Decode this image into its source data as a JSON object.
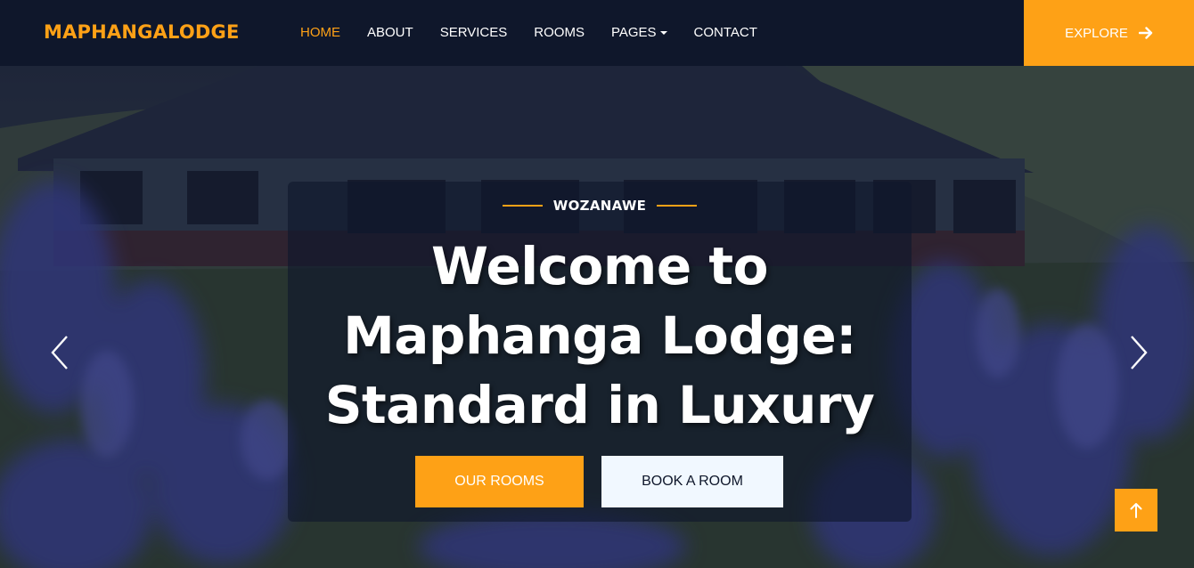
{
  "brand": "MAPHANGALODGE",
  "nav": {
    "items": [
      {
        "label": "HOME",
        "active": true
      },
      {
        "label": "ABOUT"
      },
      {
        "label": "SERVICES"
      },
      {
        "label": "ROOMS"
      },
      {
        "label": "PAGES",
        "dropdown": true
      },
      {
        "label": "CONTACT"
      }
    ],
    "explore_label": "EXPLORE"
  },
  "hero": {
    "subtitle": "WOZANAWE",
    "title_lines": [
      "Welcome to",
      "Maphanga Lodge:",
      "Standard in Luxury"
    ],
    "primary_button": "OUR ROOMS",
    "secondary_button": "BOOK A ROOM"
  },
  "colors": {
    "accent": "#fea116",
    "navy": "#0f172b",
    "light": "#f1f8ff"
  },
  "icons": {
    "explore": "arrow-right-icon",
    "prev": "chevron-left-icon",
    "next": "chevron-right-icon",
    "back_to_top": "arrow-up-icon"
  }
}
